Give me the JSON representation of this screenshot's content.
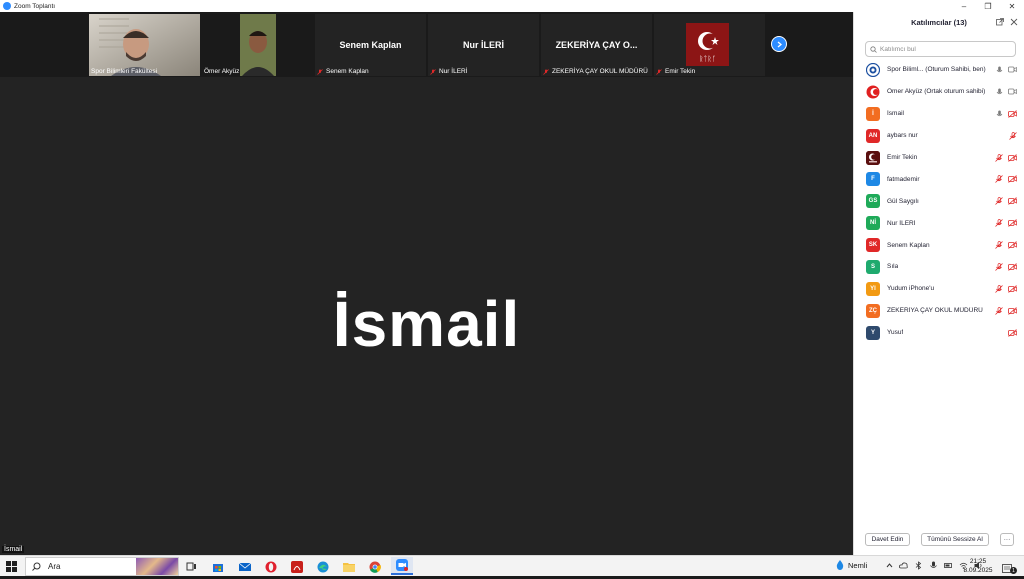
{
  "window": {
    "title": "Zoom Toplantı",
    "controls": [
      "–",
      "❐",
      "✕"
    ]
  },
  "strip": {
    "tiles": [
      {
        "name": "Spor Bilimleri Fakültesi",
        "type": "video"
      },
      {
        "name": "Ömer Akyüz",
        "type": "video"
      },
      {
        "name": "Senem Kaplan",
        "title": "Senem Kaplan",
        "type": "name"
      },
      {
        "name": "Nur İLERİ",
        "title": "Nur İLERİ",
        "type": "name"
      },
      {
        "name": "ZEKERİYA ÇAY OKUL MÜDÜRÜ",
        "title": "ZEKERİYA ÇAY O...",
        "type": "name"
      },
      {
        "name": "Emir Tekin",
        "type": "logo"
      }
    ]
  },
  "main": {
    "speaker": "İsmail",
    "bottom_label": "İsmail"
  },
  "panel": {
    "title": "Katılımcılar (13)",
    "search_placeholder": "Katılımcı bul",
    "participants": [
      {
        "initials": "",
        "name": "Spor Biliml...  (Oturum Sahibi, ben)",
        "color": "#ffffff",
        "avatar": "logo-blue",
        "mic": "on",
        "cam": "on"
      },
      {
        "initials": "",
        "name": "Ömer Akyüz (Ortak oturum sahibi)",
        "color": "#ffffff",
        "avatar": "logo-red",
        "mic": "on",
        "cam": "on"
      },
      {
        "initials": "İ",
        "name": "İsmail",
        "color": "#f26d21",
        "mic": "on",
        "cam": "off"
      },
      {
        "initials": "AN",
        "name": "aybars nur",
        "color": "#e02828",
        "mic": "off",
        "cam": "none"
      },
      {
        "initials": "",
        "name": "Emir Tekin",
        "color": "#5a0f0f",
        "avatar": "photo",
        "mic": "off",
        "cam": "off"
      },
      {
        "initials": "F",
        "name": "fatmademir",
        "color": "#1e88e5",
        "mic": "off",
        "cam": "off"
      },
      {
        "initials": "GS",
        "name": "Gül Saygılı",
        "color": "#1faa59",
        "mic": "off",
        "cam": "off"
      },
      {
        "initials": "Nİ",
        "name": "Nur İLERİ",
        "color": "#1faa59",
        "mic": "off",
        "cam": "off"
      },
      {
        "initials": "SK",
        "name": "Senem Kaplan",
        "color": "#e02828",
        "mic": "off",
        "cam": "off"
      },
      {
        "initials": "S",
        "name": "Sıla",
        "color": "#1faa6e",
        "mic": "off",
        "cam": "off"
      },
      {
        "initials": "YI",
        "name": "Yudum iPhone'u",
        "color": "#f29a13",
        "mic": "off",
        "cam": "off"
      },
      {
        "initials": "ZÇ",
        "name": "ZEKERİYA ÇAY OKUL MÜDÜRÜ",
        "color": "#f26d21",
        "mic": "off",
        "cam": "off"
      },
      {
        "initials": "Y",
        "name": "Yusuf",
        "color": "#2f4a6d",
        "mic": "none",
        "cam": "off"
      }
    ],
    "invite_label": "Davet Edin",
    "mute_all_label": "Tümünü Sessize Al",
    "more_label": "···"
  },
  "taskbar": {
    "search_text": "Ara",
    "weather": "Nemli",
    "time": "21:25",
    "date": "8.09.2025",
    "notif_count": "1"
  },
  "colors": {
    "accent": "#2d8cff",
    "muted_red": "#e02828"
  }
}
